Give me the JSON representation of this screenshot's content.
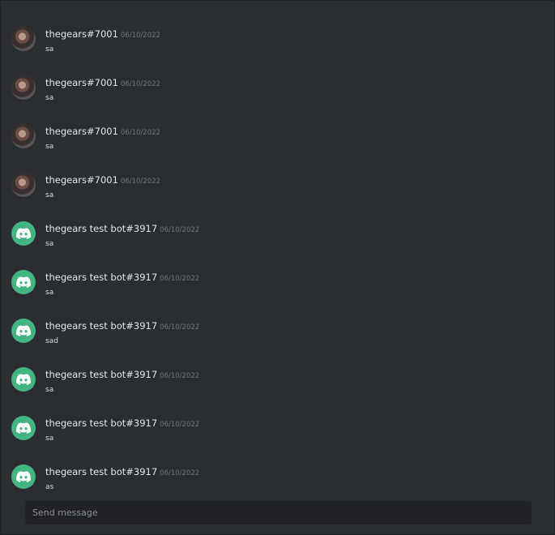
{
  "messages": [
    {
      "author": "thegears#7001",
      "timestamp": "06/10/2022",
      "text": "sa",
      "avatar": "user-avatar"
    },
    {
      "author": "thegears#7001",
      "timestamp": "06/10/2022",
      "text": "sa",
      "avatar": "user-avatar"
    },
    {
      "author": "thegears#7001",
      "timestamp": "06/10/2022",
      "text": "sa",
      "avatar": "user-avatar"
    },
    {
      "author": "thegears#7001",
      "timestamp": "06/10/2022",
      "text": "sa",
      "avatar": "user-avatar"
    },
    {
      "author": "thegears test bot#3917",
      "timestamp": "06/10/2022",
      "text": "sa",
      "avatar": "discord-bot-icon"
    },
    {
      "author": "thegears test bot#3917",
      "timestamp": "06/10/2022",
      "text": "sa",
      "avatar": "discord-bot-icon"
    },
    {
      "author": "thegears test bot#3917",
      "timestamp": "06/10/2022",
      "text": "sad",
      "avatar": "discord-bot-icon"
    },
    {
      "author": "thegears test bot#3917",
      "timestamp": "06/10/2022",
      "text": "sa",
      "avatar": "discord-bot-icon"
    },
    {
      "author": "thegears test bot#3917",
      "timestamp": "06/10/2022",
      "text": "sa",
      "avatar": "discord-bot-icon"
    },
    {
      "author": "thegears test bot#3917",
      "timestamp": "06/10/2022",
      "text": "as",
      "avatar": "discord-bot-icon"
    }
  ],
  "composer": {
    "placeholder": "Send message",
    "value": ""
  },
  "colors": {
    "background": "#2a2d31",
    "bot_avatar": "#43b581",
    "composer_bg": "#202225",
    "username": "#e6e7e9",
    "timestamp": "#72767d"
  }
}
